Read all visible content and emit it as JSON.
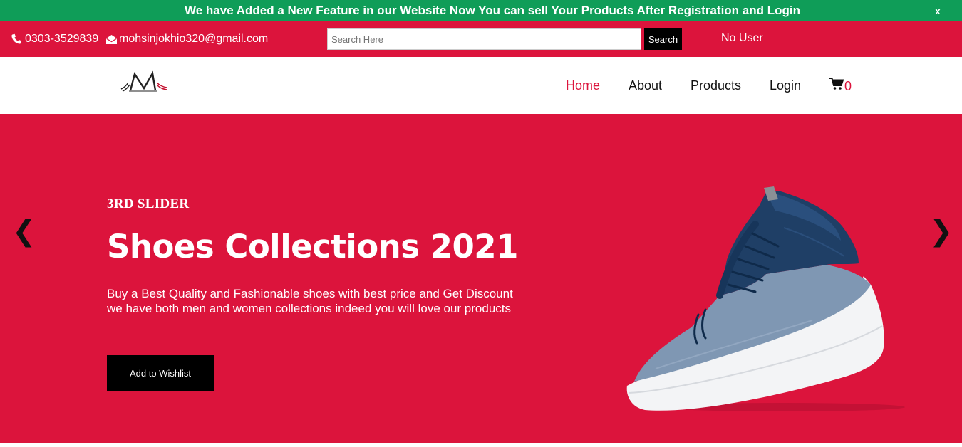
{
  "announcement": {
    "text": "We have Added a New Feature in our Website Now You can sell Your Products After Registration and Login",
    "close_label": "x"
  },
  "topbar": {
    "phone": "0303-3529839",
    "email": "mohsinjokhio320@gmail.com",
    "search_placeholder": "Search Here",
    "search_button": "Search",
    "user_status": "No User"
  },
  "nav": {
    "items": [
      {
        "label": "Home",
        "active": true
      },
      {
        "label": "About",
        "active": false
      },
      {
        "label": "Products",
        "active": false
      },
      {
        "label": "Login",
        "active": false
      }
    ],
    "cart_count": "0"
  },
  "hero": {
    "kicker": "3RD SLIDER",
    "title": "Shoes Collections 2021",
    "description": "Buy a Best Quality and Fashionable shoes with best price and Get Discount we have both men and women collections indeed you will love our products",
    "cta": "Add to Wishlist",
    "prev_arrow": "❮",
    "next_arrow": "❯"
  },
  "colors": {
    "brand_red": "#dc143c",
    "announce_green": "#0f9d58",
    "shoe_navy": "#1f3f66",
    "shoe_grey_blue": "#7f97b3"
  },
  "icons": [
    "phone-icon",
    "envelope-icon",
    "cart-icon",
    "logo-m",
    "shoe-image"
  ]
}
